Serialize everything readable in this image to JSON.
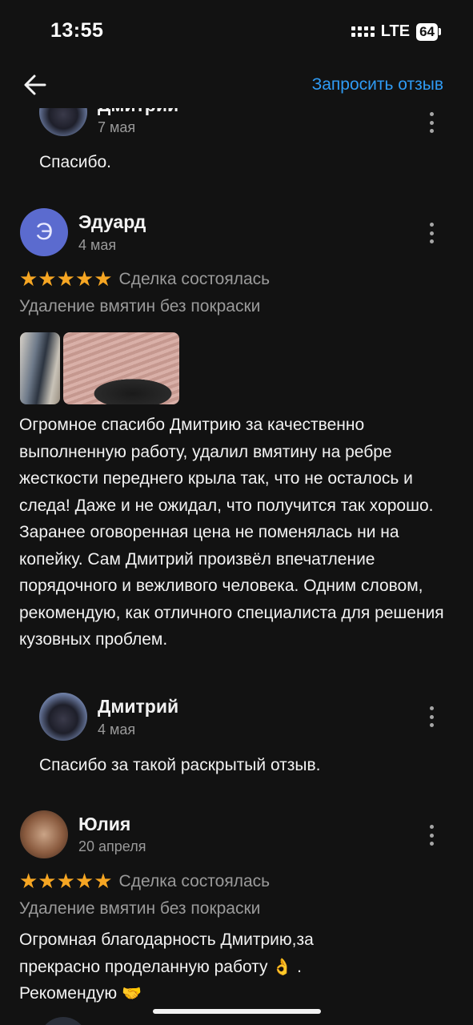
{
  "status_bar": {
    "time": "13:55",
    "network": "LTE",
    "battery": "64"
  },
  "header": {
    "back_icon": "arrow-left-icon",
    "request_review": "Запросить отзыв"
  },
  "reply_top": {
    "name": "Дмитрий",
    "date": "7 мая",
    "text": "Спасибо."
  },
  "review_eduard": {
    "avatar_letter": "Э",
    "name": "Эдуард",
    "date": "4 мая",
    "stars": "★★★★★",
    "deal_status": "Сделка состоялась",
    "service": "Удаление вмятин без покраски",
    "text": "Огромное спасибо Дмитрию за качественно выполненную работу, удалил вмятину на ребре жесткости переднего крыла так, что не осталось и следа! Даже и не ожидал, что получится так хорошо. Заранее оговоренная цена не поменялась ни на копейку. Сам Дмитрий произвёл впечатление порядочного и вежливого человека. Одним словом, рекомендую, как отличного специалиста для решения кузовных проблем."
  },
  "reply_eduard": {
    "name": "Дмитрий",
    "date": "4 мая",
    "text": "Спасибо за такой раскрытый отзыв."
  },
  "review_yulia": {
    "name": "Юлия",
    "date": "20 апреля",
    "stars": "★★★★★",
    "deal_status": "Сделка состоялась",
    "service": "Удаление вмятин без покраски",
    "text_line1": "Огромная благодарность Дмитрию,за",
    "text_line2": "прекрасно проделанную работу",
    "emoji_ok": "👌",
    "text_line2_end": ".",
    "text_line3": "Рекомендую",
    "emoji_handshake": "🤝"
  }
}
